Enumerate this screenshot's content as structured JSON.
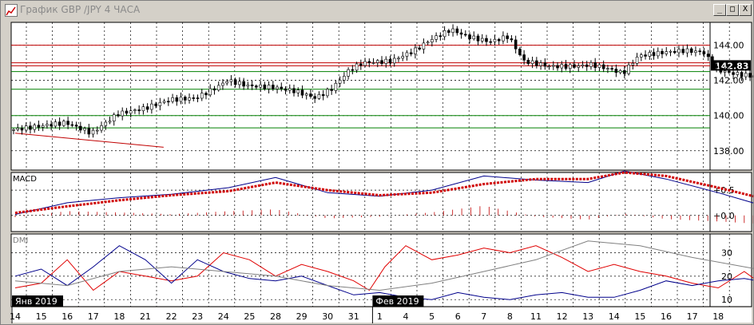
{
  "window": {
    "title": "График GBP /JPY  4 ЧАСА",
    "buttons": {
      "minimize": "_",
      "maximize": "□",
      "close": "X"
    }
  },
  "chart_data": [
    {
      "type": "candlestick",
      "title": "",
      "y_ticks": [
        "144.00",
        "142.00",
        "140.00",
        "138.00"
      ],
      "ylim": [
        136.9,
        145.3
      ],
      "current_price": "142.83",
      "x_ticks": [
        "14",
        "15",
        "16",
        "17",
        "18",
        "21",
        "22",
        "23",
        "24",
        "25",
        "28",
        "29",
        "30",
        "31",
        "1",
        "4",
        "5",
        "6",
        "7",
        "8",
        "11",
        "12",
        "13",
        "14",
        "15",
        "16",
        "17",
        "18"
      ],
      "date_markers": [
        "Янв 2019",
        "Фев 2019"
      ],
      "horizontal_levels": {
        "red": [
          144.0,
          143.0,
          142.83
        ],
        "green": [
          142.5,
          141.5,
          140.0,
          139.3
        ],
        "black_dotted": [
          144.0,
          142.0,
          140.0,
          138.0
        ]
      },
      "trendline": {
        "from": [
          0,
          139.0
        ],
        "to": [
          5.7,
          138.2
        ]
      },
      "price_path": [
        [
          0,
          139.2
        ],
        [
          1,
          139.4
        ],
        [
          2,
          139.6
        ],
        [
          3,
          139.0
        ],
        [
          4,
          140.1
        ],
        [
          5,
          140.4
        ],
        [
          6,
          140.9
        ],
        [
          7,
          141.0
        ],
        [
          7.8,
          141.6
        ],
        [
          8.2,
          142.0
        ],
        [
          9,
          141.7
        ],
        [
          10,
          141.6
        ],
        [
          10.8,
          141.4
        ],
        [
          11.6,
          141.0
        ],
        [
          12.2,
          141.5
        ],
        [
          12.9,
          142.6
        ],
        [
          13.4,
          143.0
        ],
        [
          14.5,
          143.1
        ],
        [
          15.4,
          143.7
        ],
        [
          16,
          144.3
        ],
        [
          16.8,
          144.9
        ],
        [
          17.4,
          144.5
        ],
        [
          18.3,
          144.2
        ],
        [
          19,
          144.5
        ],
        [
          19.6,
          143.1
        ],
        [
          20.6,
          142.8
        ],
        [
          21.6,
          142.8
        ],
        [
          22.2,
          142.9
        ],
        [
          23.0,
          142.6
        ],
        [
          23.4,
          142.4
        ],
        [
          24,
          143.4
        ],
        [
          25,
          143.6
        ],
        [
          25.8,
          143.7
        ],
        [
          26.5,
          143.6
        ],
        [
          27,
          142.6
        ],
        [
          27.6,
          142.4
        ],
        [
          28.6,
          142.2
        ],
        [
          29.8,
          142.4
        ],
        [
          30.3,
          142.3
        ],
        [
          31.0,
          142.1
        ],
        [
          31.8,
          142.1
        ],
        [
          32.6,
          142.2
        ],
        [
          33.4,
          142.1
        ],
        [
          34.4,
          142.3
        ],
        [
          35.4,
          142.2
        ],
        [
          36.1,
          142.4
        ],
        [
          36.8,
          142.8
        ]
      ]
    },
    {
      "type": "line",
      "indicator": "MACD",
      "title": "MACD",
      "y_ticks": [
        "+0.5",
        "+0.0"
      ],
      "ylim": [
        -0.32,
        0.85
      ],
      "series": [
        {
          "name": "",
          "color": "#00008b",
          "values": [
            [
              0,
              0.02
            ],
            [
              2,
              0.25
            ],
            [
              4,
              0.35
            ],
            [
              6,
              0.42
            ],
            [
              8.2,
              0.55
            ],
            [
              10,
              0.75
            ],
            [
              12,
              0.45
            ],
            [
              14,
              0.38
            ],
            [
              16,
              0.5
            ],
            [
              18,
              0.78
            ],
            [
              20,
              0.7
            ],
            [
              22,
              0.65
            ],
            [
              23.4,
              0.88
            ],
            [
              25,
              0.72
            ],
            [
              27,
              0.45
            ],
            [
              29,
              0.15
            ],
            [
              31,
              -0.05
            ],
            [
              32,
              -0.1
            ],
            [
              34,
              0.02
            ],
            [
              35.5,
              0.1
            ],
            [
              37,
              -0.05
            ],
            [
              39,
              -0.25
            ],
            [
              41,
              -0.2
            ],
            [
              43,
              -0.08
            ],
            [
              45,
              0.05
            ],
            [
              47,
              0.12
            ]
          ]
        },
        {
          "name": "",
          "color": "#d00000",
          "values": [
            [
              0,
              0.05
            ],
            [
              2,
              0.18
            ],
            [
              4,
              0.3
            ],
            [
              6,
              0.4
            ],
            [
              8.2,
              0.48
            ],
            [
              10,
              0.65
            ],
            [
              12,
              0.5
            ],
            [
              14,
              0.4
            ],
            [
              16,
              0.45
            ],
            [
              18,
              0.62
            ],
            [
              20,
              0.72
            ],
            [
              22,
              0.72
            ],
            [
              23.4,
              0.85
            ],
            [
              25,
              0.78
            ],
            [
              27,
              0.55
            ],
            [
              29,
              0.3
            ],
            [
              31,
              0.1
            ],
            [
              32,
              0.02
            ],
            [
              34,
              0.0
            ],
            [
              35.5,
              0.05
            ],
            [
              37,
              0.02
            ],
            [
              39,
              -0.12
            ],
            [
              41,
              -0.18
            ],
            [
              43,
              -0.1
            ],
            [
              45,
              -0.02
            ],
            [
              47,
              0.05
            ]
          ]
        }
      ]
    },
    {
      "type": "line",
      "indicator": "DMI",
      "title": "DMI",
      "y_ticks": [
        "30",
        "20",
        "10"
      ],
      "ylim": [
        7,
        38
      ],
      "series": [
        {
          "name": "",
          "color": "#e00000",
          "values": [
            [
              0,
              15
            ],
            [
              1,
              17
            ],
            [
              2,
              27
            ],
            [
              3,
              14
            ],
            [
              4,
              22
            ],
            [
              5,
              20
            ],
            [
              6,
              18
            ],
            [
              7,
              20
            ],
            [
              8,
              30
            ],
            [
              9,
              27
            ],
            [
              10,
              20
            ],
            [
              11,
              25
            ],
            [
              12,
              22
            ],
            [
              13,
              18
            ],
            [
              13.6,
              14
            ],
            [
              14.2,
              24
            ],
            [
              15,
              33
            ],
            [
              16,
              27
            ],
            [
              17,
              29
            ],
            [
              18,
              32
            ],
            [
              19,
              30
            ],
            [
              20,
              33
            ],
            [
              21,
              28
            ],
            [
              22,
              22
            ],
            [
              23,
              25
            ],
            [
              24,
              22
            ],
            [
              25,
              20
            ],
            [
              26,
              17
            ],
            [
              27,
              15
            ],
            [
              28,
              22
            ],
            [
              29,
              14
            ],
            [
              30,
              21
            ],
            [
              31,
              14
            ],
            [
              32,
              16
            ],
            [
              33,
              21
            ],
            [
              34,
              13
            ],
            [
              35,
              12
            ],
            [
              36,
              15
            ],
            [
              37,
              13
            ],
            [
              38,
              15
            ],
            [
              39,
              13
            ],
            [
              40,
              17
            ],
            [
              41,
              13
            ],
            [
              42,
              17
            ],
            [
              43,
              14
            ],
            [
              44,
              20
            ],
            [
              45,
              18
            ],
            [
              46,
              20
            ],
            [
              47,
              22
            ]
          ]
        },
        {
          "name": "",
          "color": "#00008b",
          "values": [
            [
              0,
              20
            ],
            [
              1,
              23
            ],
            [
              2,
              16
            ],
            [
              3,
              24
            ],
            [
              4,
              33
            ],
            [
              5,
              27
            ],
            [
              6,
              17
            ],
            [
              7,
              27
            ],
            [
              8,
              22
            ],
            [
              9,
              19
            ],
            [
              10,
              18
            ],
            [
              11,
              20
            ],
            [
              12,
              16
            ],
            [
              13,
              12
            ],
            [
              14,
              13
            ],
            [
              15,
              11
            ],
            [
              16,
              10
            ],
            [
              17,
              13
            ],
            [
              18,
              11
            ],
            [
              19,
              10
            ],
            [
              20,
              12
            ],
            [
              21,
              13
            ],
            [
              22,
              11
            ],
            [
              23,
              11
            ],
            [
              24,
              14
            ],
            [
              25,
              18
            ],
            [
              26,
              16
            ],
            [
              27,
              18
            ],
            [
              28,
              19
            ],
            [
              29,
              17
            ],
            [
              30,
              23
            ],
            [
              31,
              19
            ],
            [
              32,
              16
            ],
            [
              33,
              20
            ],
            [
              34,
              15
            ],
            [
              35,
              22
            ],
            [
              36,
              24
            ],
            [
              37,
              20
            ],
            [
              38,
              26
            ],
            [
              39,
              20
            ],
            [
              40,
              25
            ],
            [
              41,
              22
            ],
            [
              42,
              19
            ],
            [
              43,
              18
            ],
            [
              44,
              15
            ],
            [
              45,
              12
            ],
            [
              46,
              11
            ],
            [
              47,
              10
            ]
          ]
        },
        {
          "name": "",
          "color": "#808080",
          "values": [
            [
              0,
              18
            ],
            [
              2,
              16
            ],
            [
              4,
              22
            ],
            [
              6,
              24
            ],
            [
              8,
              22
            ],
            [
              10,
              20
            ],
            [
              12,
              16
            ],
            [
              14,
              14
            ],
            [
              16,
              17
            ],
            [
              18,
              22
            ],
            [
              20,
              27
            ],
            [
              22,
              35
            ],
            [
              24,
              33
            ],
            [
              26,
              28
            ],
            [
              28,
              24
            ],
            [
              30,
              20
            ],
            [
              32,
              16
            ],
            [
              34,
              15
            ],
            [
              36,
              18
            ],
            [
              38,
              20
            ],
            [
              40,
              24
            ],
            [
              42,
              22
            ],
            [
              44,
              20
            ],
            [
              46,
              18
            ],
            [
              47,
              17
            ]
          ]
        }
      ]
    }
  ]
}
